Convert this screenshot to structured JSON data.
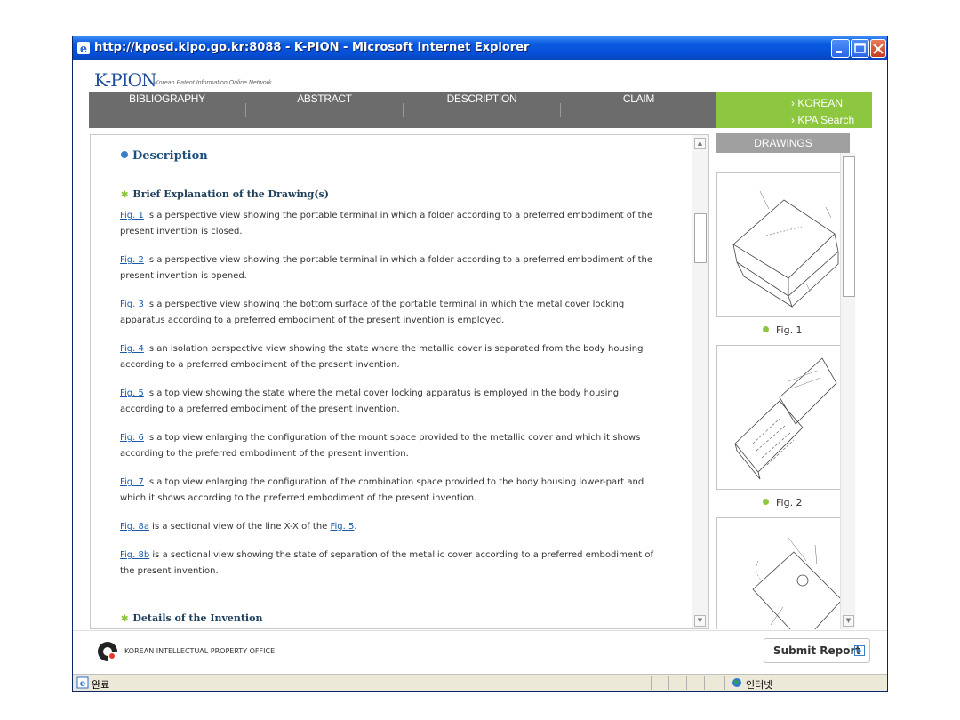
{
  "window": {
    "title": "http://kposd.kipo.go.kr:8088 - K-PION - Microsoft Internet Explorer",
    "controls": [
      "minimize-icon",
      "maximize-icon",
      "close-icon"
    ]
  },
  "brand": {
    "name": "K-PION",
    "subtitle": "Korean Patent Information Online Network"
  },
  "tabs": [
    {
      "label": "BIBLIOGRAPHY"
    },
    {
      "label": "ABSTRACT"
    },
    {
      "label": "DESCRIPTION"
    },
    {
      "label": "CLAIM"
    }
  ],
  "side_links": [
    "› KOREAN",
    "› KPA Search"
  ],
  "content": {
    "heading": "Description",
    "section1": "Brief Explanation of the Drawing(s)",
    "items": [
      {
        "link": "Fig. 1",
        "text": " is a perspective view showing the portable terminal in which a folder according to a preferred embodiment of the present invention is closed."
      },
      {
        "link": "Fig. 2",
        "text": " is a perspective view showing the portable terminal in which a folder according to a preferred embodiment of the present invention is opened."
      },
      {
        "link": "Fig. 3",
        "text": " is a perspective view showing the bottom surface of the portable terminal in which the metal cover locking apparatus according to a preferred embodiment of the present invention is employed."
      },
      {
        "link": "Fig. 4",
        "text": " is an isolation perspective view showing the state where the metallic cover is separated from the body housing according to a preferred embodiment of the present invention."
      },
      {
        "link": "Fig. 5",
        "text": " is a top view showing the state where the metal cover locking apparatus is employed in the body housing according to a preferred embodiment of the present invention."
      },
      {
        "link": "Fig. 6",
        "text": " is a top view enlarging the configuration of the mount space provided to the metallic cover and which it shows according to the preferred embodiment of the present invention."
      },
      {
        "link": "Fig. 7",
        "text": " is a top view enlarging the configuration of the combination space provided to the body housing lower-part and which it shows according to the preferred embodiment of the present invention."
      },
      {
        "link": "Fig. 8a",
        "text": " is a sectional view of the line X-X of the ",
        "link2": "Fig. 5",
        "text2": "."
      },
      {
        "link": "Fig. 8b",
        "text": " is a sectional view showing the state of separation of the metallic cover according to a preferred embodiment of the present invention."
      }
    ],
    "section2": "Details of the Invention"
  },
  "drawings": {
    "header": "DRAWINGS",
    "figures": [
      {
        "caption": "Fig. 1"
      },
      {
        "caption": "Fig. 2"
      }
    ]
  },
  "footer": {
    "org": "KOREAN INTELLECTUAL PROPERTY OFFICE",
    "submit": "Submit Report"
  },
  "status": {
    "left": "완료",
    "zone": "인터넷"
  }
}
